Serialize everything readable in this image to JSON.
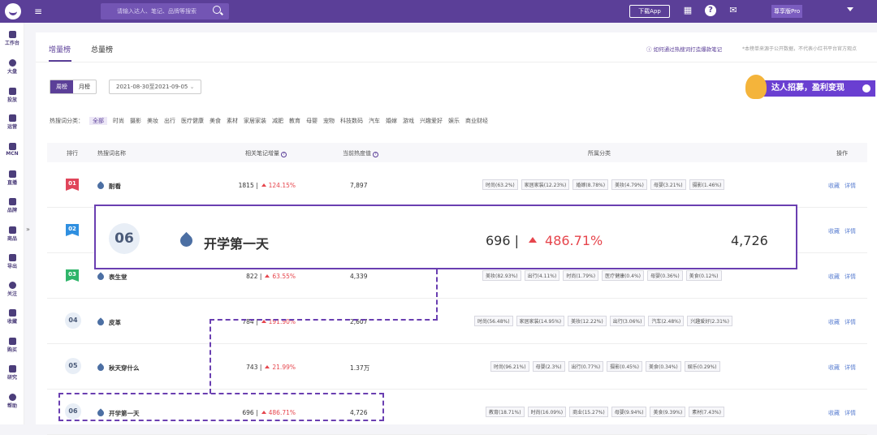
{
  "topbar": {
    "search_placeholder": "请输入达人、笔记、品牌等搜索",
    "download_label": "下载App",
    "account_label": "尊享版Pro"
  },
  "sidebar": {
    "items": [
      "工作台",
      "大盘",
      "投放",
      "运营",
      "MCN",
      "直播",
      "品牌",
      "商品",
      "导出",
      "关注",
      "收藏",
      "购买",
      "研究",
      "帮助"
    ],
    "collapse": "»"
  },
  "tabs": [
    "增量榜",
    "总量榜"
  ],
  "howto_link": "如何通过热搜词打造爆款笔记",
  "note": "*本榜单来源于公开数据，不代表小红书平台官方观点",
  "period_toggle": {
    "weekly": "周榜",
    "monthly": "月榜"
  },
  "date_range": "2021-08-30至2021-09-05",
  "banner_text": "达人招募，盈利变现",
  "categories_label": "热搜词分类：",
  "categories": [
    "全部",
    "时尚",
    "摄影",
    "美妆",
    "出行",
    "医疗健康",
    "美食",
    "素材",
    "家居家装",
    "减肥",
    "教育",
    "母婴",
    "宠物",
    "科技数码",
    "汽车",
    "婚嫁",
    "游戏",
    "兴趣爱好",
    "娱乐",
    "商业财经"
  ],
  "table": {
    "headers": {
      "rank": "排行",
      "word": "热搜词名称",
      "growth": "相关笔记增量",
      "heat": "当前热度值",
      "category": "所属分类",
      "ops": "操作"
    },
    "rows": [
      {
        "rank": "01",
        "word": "耐看",
        "count": "1815 |",
        "pct": "124.15%",
        "heat": "7,897",
        "tags": [
          "时尚(63.2%)",
          "家居家装(12.23%)",
          "婚嫁(8.78%)",
          "美妆(4.79%)",
          "母婴(3.21%)",
          "摄影(1.46%)"
        ]
      },
      {
        "rank": "02",
        "word": "",
        "count": "",
        "pct": "",
        "heat": "",
        "tags": []
      },
      {
        "rank": "03",
        "word": "表生堂",
        "count": "822 |",
        "pct": "63.55%",
        "heat": "4,339",
        "tags": [
          "美妆(82.93%)",
          "出行(4.11%)",
          "时尚(1.79%)",
          "医疗健康(0.4%)",
          "母婴(0.36%)",
          "美食(0.12%)"
        ]
      },
      {
        "rank": "04",
        "word": "皮革",
        "count": "784 |",
        "pct": "191.90%",
        "heat": "2,607",
        "tags": [
          "时尚(56.48%)",
          "家居家装(14.95%)",
          "美妆(12.22%)",
          "出行(3.06%)",
          "汽车(2.48%)",
          "兴趣爱好(2.31%)"
        ]
      },
      {
        "rank": "05",
        "word": "秋天穿什么",
        "count": "743 |",
        "pct": "21.99%",
        "heat": "1.37万",
        "tags": [
          "时尚(96.21%)",
          "母婴(2.3%)",
          "出行(0.77%)",
          "摄影(0.45%)",
          "美食(0.34%)",
          "娱乐(0.29%)"
        ]
      },
      {
        "rank": "06",
        "word": "开学第一天",
        "count": "696 |",
        "pct": "486.71%",
        "heat": "4,726",
        "tags": [
          "教育(18.71%)",
          "时尚(16.09%)",
          "商业(15.27%)",
          "母婴(9.94%)",
          "美食(9.39%)",
          "素材(7.43%)"
        ]
      }
    ],
    "ops": [
      "收藏",
      "详情"
    ]
  },
  "zoom": {
    "rank": "06",
    "word": "开学第一天",
    "count": "696 |",
    "pct": "486.71%",
    "heat": "4,726"
  },
  "colors": {
    "brand": "#5b3f98",
    "accent_red": "#e6454c",
    "link_blue": "#5b7fd1"
  }
}
